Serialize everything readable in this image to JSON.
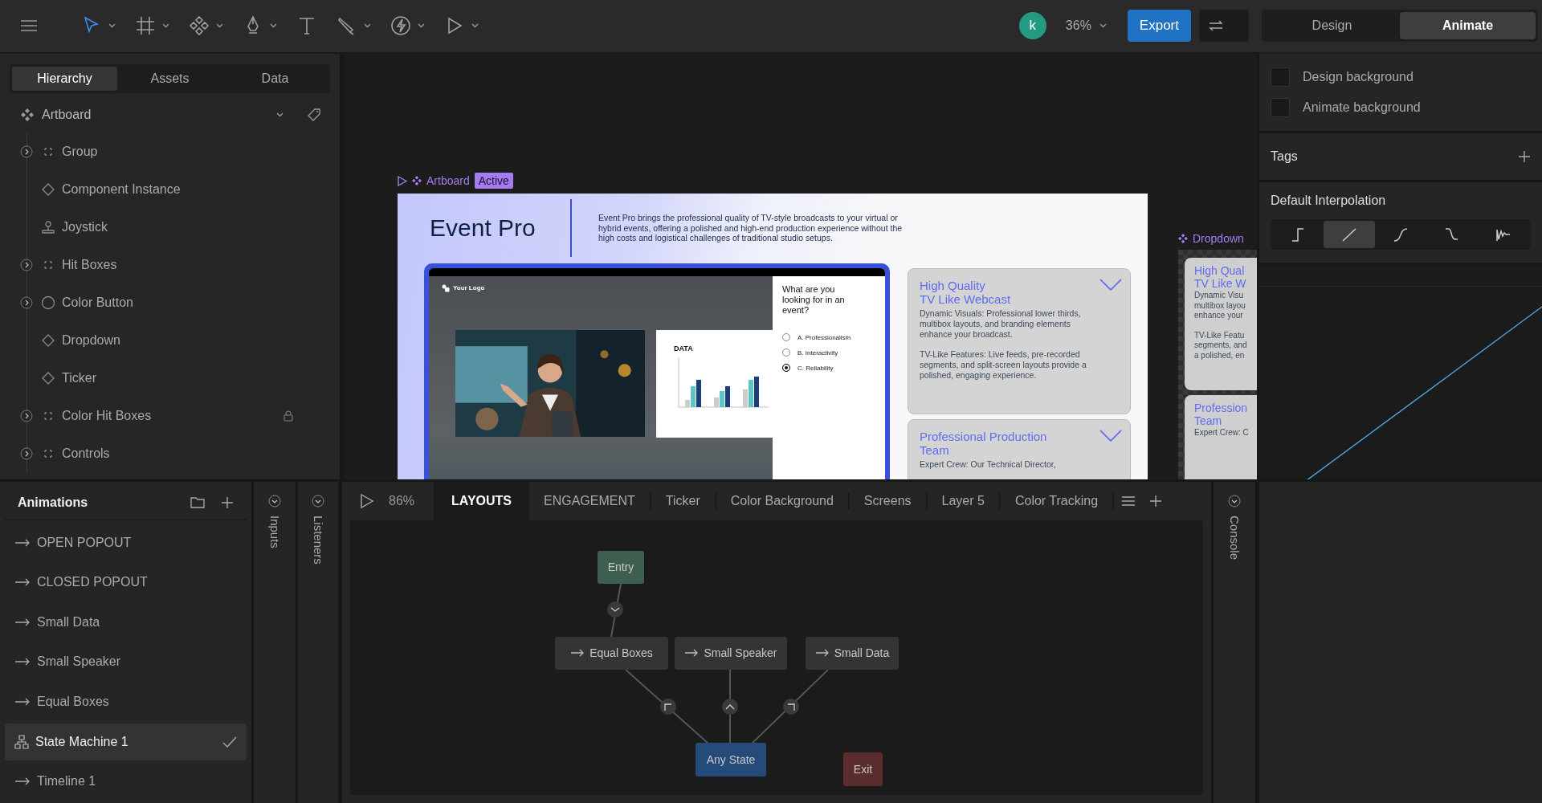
{
  "toolbar": {
    "tools": [
      {
        "kind": "select",
        "selected": true,
        "menu": true
      },
      {
        "kind": "frame",
        "selected": false,
        "menu": true
      },
      {
        "kind": "component",
        "selected": false,
        "menu": true
      },
      {
        "kind": "pen",
        "selected": false,
        "menu": true
      },
      {
        "kind": "text",
        "selected": false,
        "menu": false
      },
      {
        "kind": "brush",
        "selected": false,
        "menu": true
      },
      {
        "kind": "event",
        "selected": false,
        "menu": true
      },
      {
        "kind": "play",
        "selected": false,
        "menu": true
      }
    ],
    "avatar": "k",
    "zoom": "36%",
    "export": "Export",
    "modes": [
      {
        "label": "Design",
        "selected": false
      },
      {
        "label": "Animate",
        "selected": true
      }
    ]
  },
  "left_tabs": [
    {
      "label": "Hierarchy",
      "selected": true
    },
    {
      "label": "Assets",
      "selected": false
    },
    {
      "label": "Data",
      "selected": false
    }
  ],
  "hierarchy": {
    "root": "Artboard",
    "items": [
      {
        "label": "Group",
        "kind": "group",
        "expandable": true,
        "locked": false
      },
      {
        "label": "Component Instance",
        "kind": "component",
        "expandable": false,
        "locked": false
      },
      {
        "label": "Joystick",
        "kind": "joystick",
        "expandable": false,
        "locked": false
      },
      {
        "label": "Hit Boxes",
        "kind": "group",
        "expandable": true,
        "locked": false
      },
      {
        "label": "Color Button",
        "kind": "ellipse",
        "expandable": true,
        "locked": false
      },
      {
        "label": "Dropdown",
        "kind": "component",
        "expandable": false,
        "locked": false
      },
      {
        "label": "Ticker",
        "kind": "component",
        "expandable": false,
        "locked": false
      },
      {
        "label": "Color Hit Boxes",
        "kind": "group",
        "expandable": true,
        "locked": true
      },
      {
        "label": "Controls",
        "kind": "group",
        "expandable": true,
        "locked": false
      }
    ]
  },
  "canvas": {
    "artboard_label": "Artboard",
    "badge": "Active",
    "artboard": {
      "title": "Event Pro",
      "description": "Event Pro brings the professional quality of TV-style broadcasts to your virtual or hybrid events, offering a polished and high-end production experience without the high costs and logistical challenges of traditional studio setups.",
      "logo": "Your Logo",
      "chart_label": "DATA",
      "question": "What are you looking for in an event?",
      "options": [
        {
          "label": "A. Professionalism",
          "selected": false
        },
        {
          "label": "B. Interactivity",
          "selected": false
        },
        {
          "label": "C. Reliability",
          "selected": true
        }
      ],
      "cards": [
        {
          "title_lines": [
            "High Quality",
            "TV Like Webcast"
          ],
          "paragraphs": [
            "Dynamic Visuals: Professional lower thirds, multibox layouts, and branding elements enhance your broadcast.",
            "TV-Like Features: Live feeds, pre-recorded segments, and split-screen layouts provide a polished, engaging experience."
          ]
        },
        {
          "title_lines": [
            "Professional Production",
            "Team"
          ],
          "paragraphs": [
            "Expert Crew: Our Technical Director,"
          ]
        }
      ]
    },
    "dropdown": {
      "label": "Dropdown",
      "cards": [
        {
          "title_lines": [
            "High Qual",
            "TV Like W"
          ],
          "paragraphs": [
            [
              "Dynamic Visu",
              "multibox layou",
              "enhance your"
            ],
            [
              "TV-Like Featu",
              "segments, and",
              "a polished, en"
            ]
          ]
        },
        {
          "title_lines": [
            "Profession",
            "Team"
          ],
          "paragraphs": [
            [
              "Expert Crew: C"
            ]
          ]
        }
      ]
    }
  },
  "inspector": {
    "backgrounds": [
      {
        "label": "Design background",
        "checked": false
      },
      {
        "label": "Animate background",
        "checked": false
      }
    ],
    "tags": "Tags",
    "interpolation": {
      "title": "Default Interpolation",
      "options": [
        {
          "kind": "hold",
          "selected": false
        },
        {
          "kind": "linear",
          "selected": true
        },
        {
          "kind": "cubic",
          "selected": false
        },
        {
          "kind": "custom",
          "selected": false
        },
        {
          "kind": "elastic",
          "selected": false
        }
      ]
    }
  },
  "animations": {
    "title": "Animations",
    "items": [
      {
        "label": "OPEN POPOUT",
        "kind": "animation",
        "selected": false
      },
      {
        "label": "CLOSED POPOUT",
        "kind": "animation",
        "selected": false
      },
      {
        "label": "Small Data",
        "kind": "animation",
        "selected": false
      },
      {
        "label": "Small Speaker",
        "kind": "animation",
        "selected": false
      },
      {
        "label": "Equal Boxes",
        "kind": "animation",
        "selected": false
      },
      {
        "label": "State Machine 1",
        "kind": "state_machine",
        "selected": true
      },
      {
        "label": "Timeline 1",
        "kind": "animation",
        "selected": false
      }
    ]
  },
  "side_tabs": [
    "Inputs",
    "Listeners"
  ],
  "graph": {
    "zoom": "86%",
    "tabs": [
      {
        "label": "LAYOUTS",
        "selected": true
      },
      {
        "label": "ENGAGEMENT",
        "selected": false
      },
      {
        "label": "Ticker",
        "selected": false
      },
      {
        "label": "Color Background",
        "selected": false
      },
      {
        "label": "Screens",
        "selected": false
      },
      {
        "label": "Layer 5",
        "selected": false
      },
      {
        "label": "Color Tracking",
        "selected": false
      }
    ],
    "nodes": [
      {
        "label": "Entry",
        "kind": "entry"
      },
      {
        "label": "Equal Boxes",
        "kind": "animation"
      },
      {
        "label": "Small Speaker",
        "kind": "animation"
      },
      {
        "label": "Small Data",
        "kind": "animation"
      },
      {
        "label": "Any State",
        "kind": "any"
      },
      {
        "label": "Exit",
        "kind": "exit"
      }
    ]
  },
  "console": "Console"
}
